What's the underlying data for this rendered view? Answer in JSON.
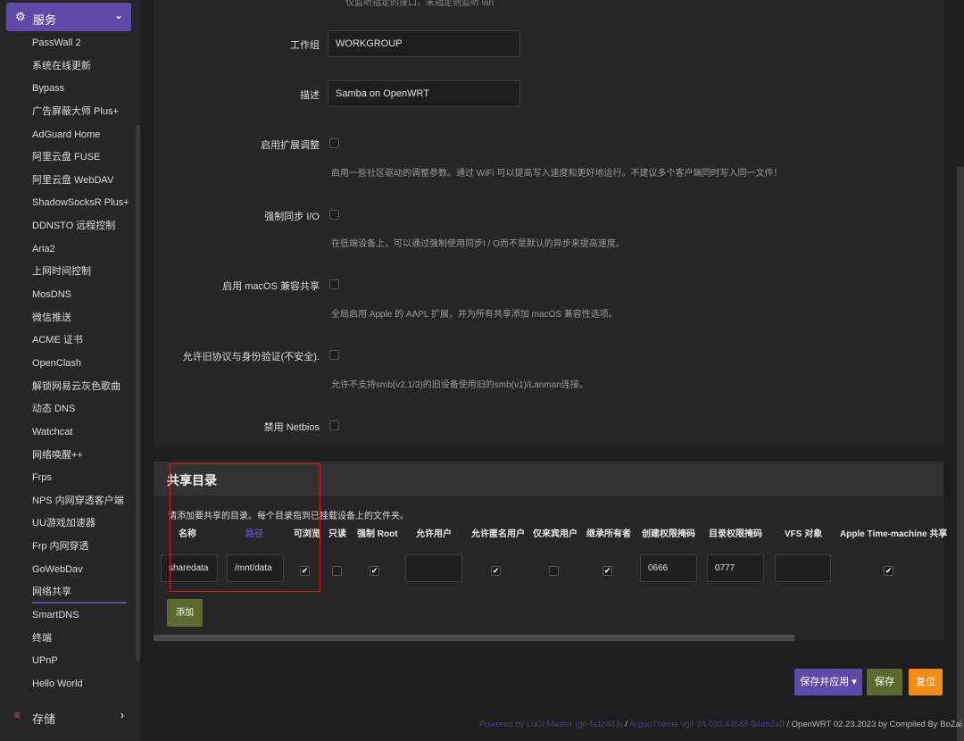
{
  "sidebar": {
    "services_label": "服务",
    "storage_label": "存储",
    "items": [
      "PassWall 2",
      "系统在线更新",
      "Bypass",
      "广告屏蔽大师 Plus+",
      "AdGuard Home",
      "阿里云盘 FUSE",
      "阿里云盘 WebDAV",
      "ShadowSocksR Plus+",
      "DDNSTO 远程控制",
      "Aria2",
      "上网时间控制",
      "MosDNS",
      "微信推送",
      "ACME 证书",
      "OpenClash",
      "解锁网易云灰色歌曲",
      "动态 DNS",
      "Watchcat",
      "网络唤醒++",
      "Frps",
      "NPS 内网穿透客户端",
      "UU游戏加速器",
      "Frp 内网穿透",
      "GoWebDav",
      "网络共享",
      "SmartDNS",
      "终端",
      "UPnP",
      "Hello World"
    ],
    "active_item": "网络共享"
  },
  "form": {
    "cut_text": "仅监听指定的接口，未指定则监听 lan",
    "workgroup_label": "工作组",
    "workgroup_value": "WORKGROUP",
    "description_label": "描述",
    "description_value": "Samba on OpenWRT",
    "ext_tune_label": "启用扩展调整",
    "ext_tune_desc": "启用一些社区驱动的调整参数。通过 WiFi 可以提高写入速度和更好地运行。不建议多个客户端同时写入同一文件！",
    "sync_io_label": "强制同步 I/O",
    "sync_io_desc": "在低端设备上，可以通过强制使用同步I / O而不是默认的异步来提高速度。",
    "macos_label": "启用 macOS 兼容共享",
    "macos_desc": "全局启用 Apple 的 AAPL 扩展，并为所有共享添加 macOS 兼容性选项。",
    "legacy_label": "允许旧协议与身份验证(不安全).",
    "legacy_desc": "允许不支持smb(v2.1/3)的旧设备使用旧的smb(v1)/Lanman连接。",
    "netbios_label": "禁用 Netbios"
  },
  "shares": {
    "title": "共享目录",
    "description": "请添加要共享的目录。每个目录指到已挂载设备上的文件夹。",
    "headers": [
      "名称",
      "路径",
      "可浏览",
      "只读",
      "强制 Root",
      "允许用户",
      "允许匿名用户",
      "仅来宾用户",
      "继承所有者",
      "创建权限掩码",
      "目录权限掩码",
      "VFS 对象",
      "Apple Time-machine 共享"
    ],
    "row": {
      "name": "sharedata",
      "path": "/mnt/data",
      "browseable": true,
      "read_only": false,
      "force_root": true,
      "allow_users": "",
      "allow_guests": true,
      "guest_only": false,
      "inherit_owner": true,
      "create_mask": "0666",
      "dir_mask": "0777",
      "vfs_objects": "",
      "timemachine": true
    },
    "add_label": "添加"
  },
  "actions": {
    "save_apply": "保存并应用",
    "save": "保存",
    "reset": "复位"
  },
  "footer": {
    "luci": "Powered by LuCI Master (git-fa1c483)",
    "theme": "ArgonTheme vgit-24.033.44588-94eb2a9",
    "openwrt": "/ OpenWRT 02.23.2023 by Compiled By BoZai"
  },
  "icons": {
    "services": "gears-icon",
    "storage": "database-icon"
  }
}
